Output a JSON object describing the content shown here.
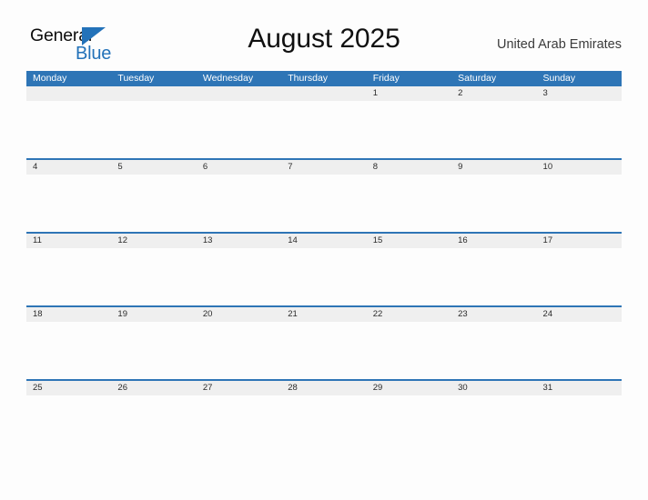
{
  "brand": {
    "name_part1": "General",
    "name_part2": "Blue",
    "triangle_color": "#2372b9"
  },
  "header": {
    "title": "August 2025",
    "country": "United Arab Emirates"
  },
  "theme": {
    "header_blue": "#2e75b6",
    "date_band_gray": "#efefef",
    "page_background": "#fdfdfd",
    "date_text": "#2b2b2b",
    "weekday_text": "#ffffff"
  },
  "calendar": {
    "weekdays": [
      "Monday",
      "Tuesday",
      "Wednesday",
      "Thursday",
      "Friday",
      "Saturday",
      "Sunday"
    ],
    "weeks": [
      [
        "",
        "",
        "",
        "",
        "1",
        "2",
        "3"
      ],
      [
        "4",
        "5",
        "6",
        "7",
        "8",
        "9",
        "10"
      ],
      [
        "11",
        "12",
        "13",
        "14",
        "15",
        "16",
        "17"
      ],
      [
        "18",
        "19",
        "20",
        "21",
        "22",
        "23",
        "24"
      ],
      [
        "25",
        "26",
        "27",
        "28",
        "29",
        "30",
        "31"
      ]
    ]
  }
}
